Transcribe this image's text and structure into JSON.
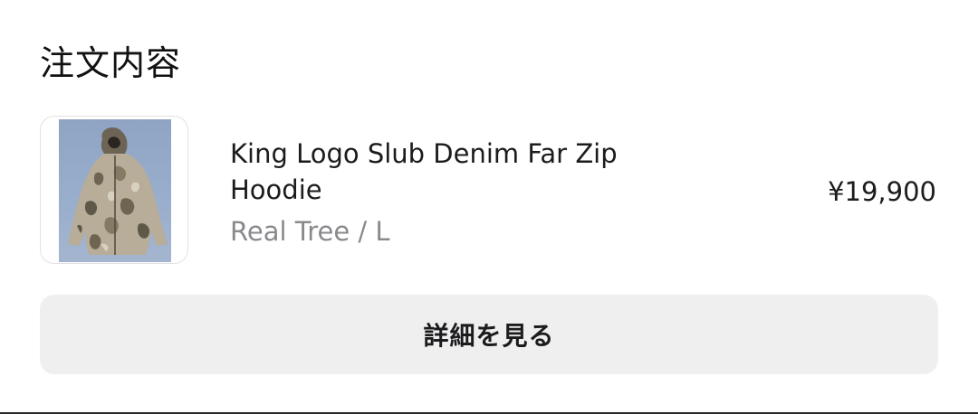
{
  "order": {
    "section_title": "注文内容",
    "items": [
      {
        "name": "King Logo Slub Denim Far Zip Hoodie",
        "variant": "Real Tree / L",
        "price": "¥19,900",
        "thumbnail_icon": "camo-hoodie-image"
      }
    ],
    "details_button_label": "詳細を見る"
  }
}
